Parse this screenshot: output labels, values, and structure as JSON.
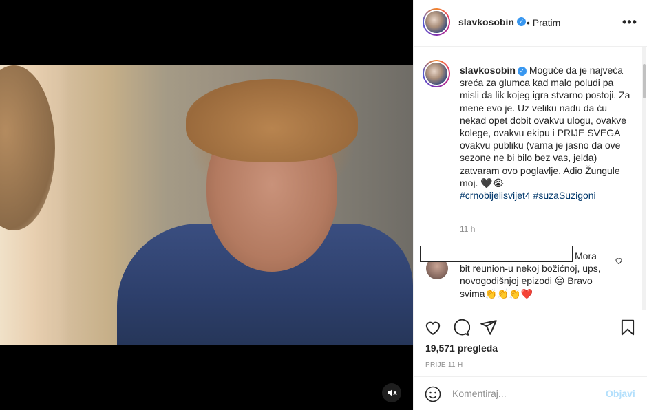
{
  "header": {
    "username": "slavkosobin",
    "follow_label": "• Pratim",
    "more_label": "•••"
  },
  "caption": {
    "username": "slavkosobin",
    "text": "Moguće da je najveća sreća za glumca kad malo poludi pa misli da lik kojeg igra stvarno postoji. Za mene evo je. Uz veliku nadu da ću nekad opet dobit ovakvu ulogu, ovakve kolege, ovakvu ekipu i PRIJE SVEGA ovakvu publiku (vama je jasno da ove sezone ne bi bilo bez vas, jelda) zatvaram ovo poglavlje. Adio Žungule moj. 🖤😭",
    "hashtag_1": "#crnobijelisvijet4",
    "hashtag_2": "#suzaSuzigoni",
    "time_ago": "11 h"
  },
  "comment": {
    "text": "Mora bit reunion-u nekoj božićnoj, ups, novogodišnjoj epizodi 😑 Bravo svima👏👏👏❤️"
  },
  "stats": {
    "views": "19,571 pregleda",
    "date": "PRIJE 11 H"
  },
  "add_comment": {
    "placeholder": "Komentiraj...",
    "post_label": "Objavi"
  },
  "colors": {
    "verified": "#3897f0",
    "hashtag": "#00376b",
    "post_disabled": "#b2dffc"
  },
  "icons": {
    "verified": "verified-badge-icon",
    "like": "heart-icon",
    "comment": "comment-icon",
    "share": "paper-plane-icon",
    "save": "bookmark-icon",
    "emoji": "emoji-icon",
    "mute": "sound-off-icon"
  }
}
